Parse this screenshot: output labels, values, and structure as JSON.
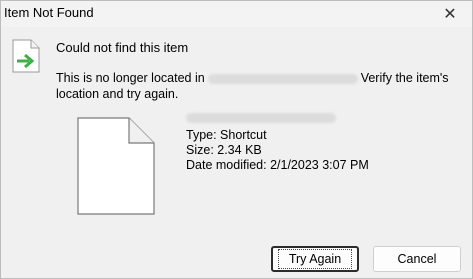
{
  "window": {
    "title": "Item Not Found",
    "close_label": "✕"
  },
  "main": {
    "heading": "Could not find this item",
    "message_prefix": "This is no longer located in",
    "message_suffix": "Verify the item's location and try again.",
    "details": {
      "type": "Type: Shortcut",
      "size": "Size: 2.34 KB",
      "date_modified": "Date modified: 2/1/2023 3:07 PM"
    }
  },
  "buttons": {
    "try_again": "Try Again",
    "cancel": "Cancel"
  },
  "icons": {
    "shortcut": "shortcut-arrow-icon",
    "file": "blank-file-icon"
  },
  "colors": {
    "arrow": "#3fae49"
  }
}
